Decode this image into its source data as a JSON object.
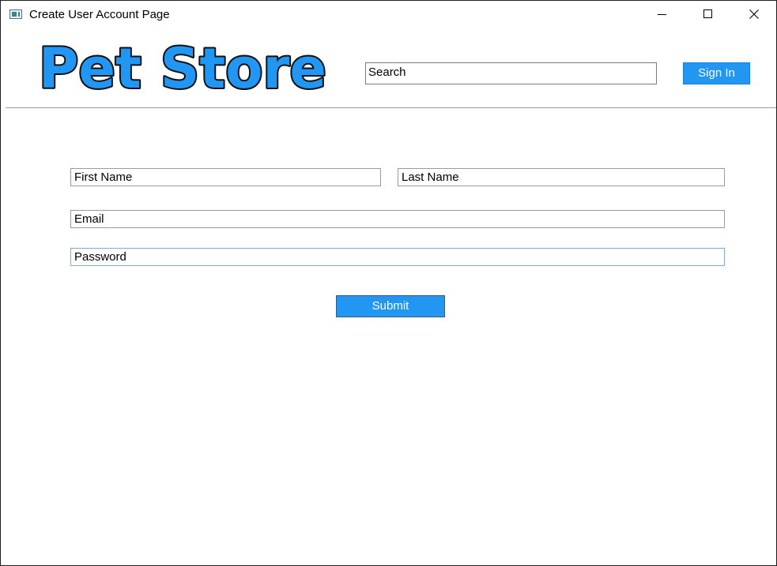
{
  "window": {
    "title": "Create User Account Page",
    "controls": {
      "minimize": "minimize-icon",
      "maximize": "maximize-icon",
      "close": "close-icon"
    }
  },
  "header": {
    "logo_text": "Pet Store",
    "search_value": "Search",
    "sign_in_label": "Sign In"
  },
  "form": {
    "first_name": "First Name",
    "last_name": "Last Name",
    "email": "Email",
    "password": "Password",
    "submit_label": "Submit"
  },
  "colors": {
    "accent": "#2196F3",
    "logo_fill": "#2196F3",
    "logo_outline": "#111111"
  }
}
